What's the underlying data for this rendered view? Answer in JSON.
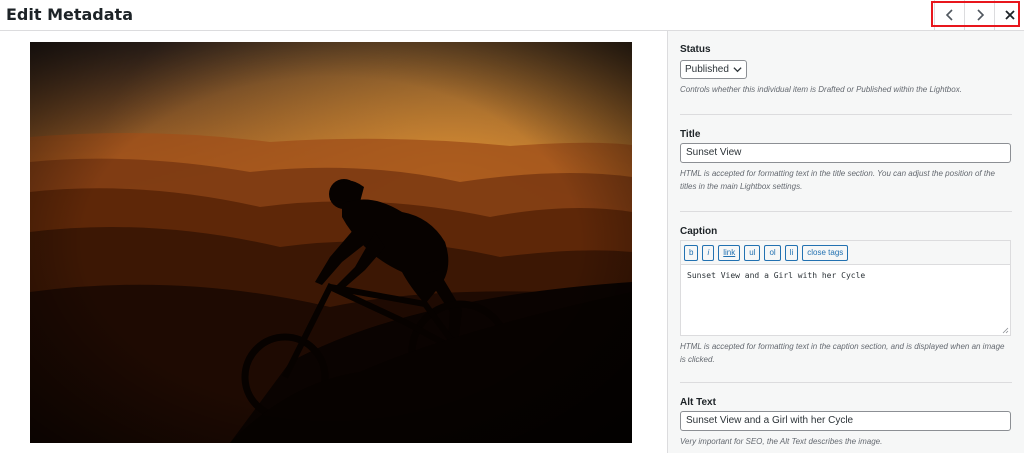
{
  "header": {
    "title": "Edit Metadata",
    "nav": {
      "prev_icon": "chevron-left-icon",
      "next_icon": "chevron-right-icon",
      "close_icon": "close-icon",
      "highlight_color": "#e8161c"
    }
  },
  "image": {
    "description_icon": "sunset-cyclist-photo"
  },
  "sidebar": {
    "status": {
      "label": "Status",
      "value": "Published",
      "help": "Controls whether this individual item is Drafted or Published within the Lightbox."
    },
    "title": {
      "label": "Title",
      "value": "Sunset View",
      "help": "HTML is accepted for formatting text in the title section. You can adjust the position of the titles in the main Lightbox settings."
    },
    "caption": {
      "label": "Caption",
      "buttons": [
        "b",
        "i",
        "link",
        "ul",
        "ol",
        "li",
        "close tags"
      ],
      "value": "Sunset View and a Girl with her Cycle",
      "help": "HTML is accepted for formatting text in the caption section, and is displayed when an image is clicked."
    },
    "alt": {
      "label": "Alt Text",
      "value": "Sunset View and a Girl with her Cycle",
      "help": "Very important for SEO, the Alt Text describes the image."
    }
  }
}
